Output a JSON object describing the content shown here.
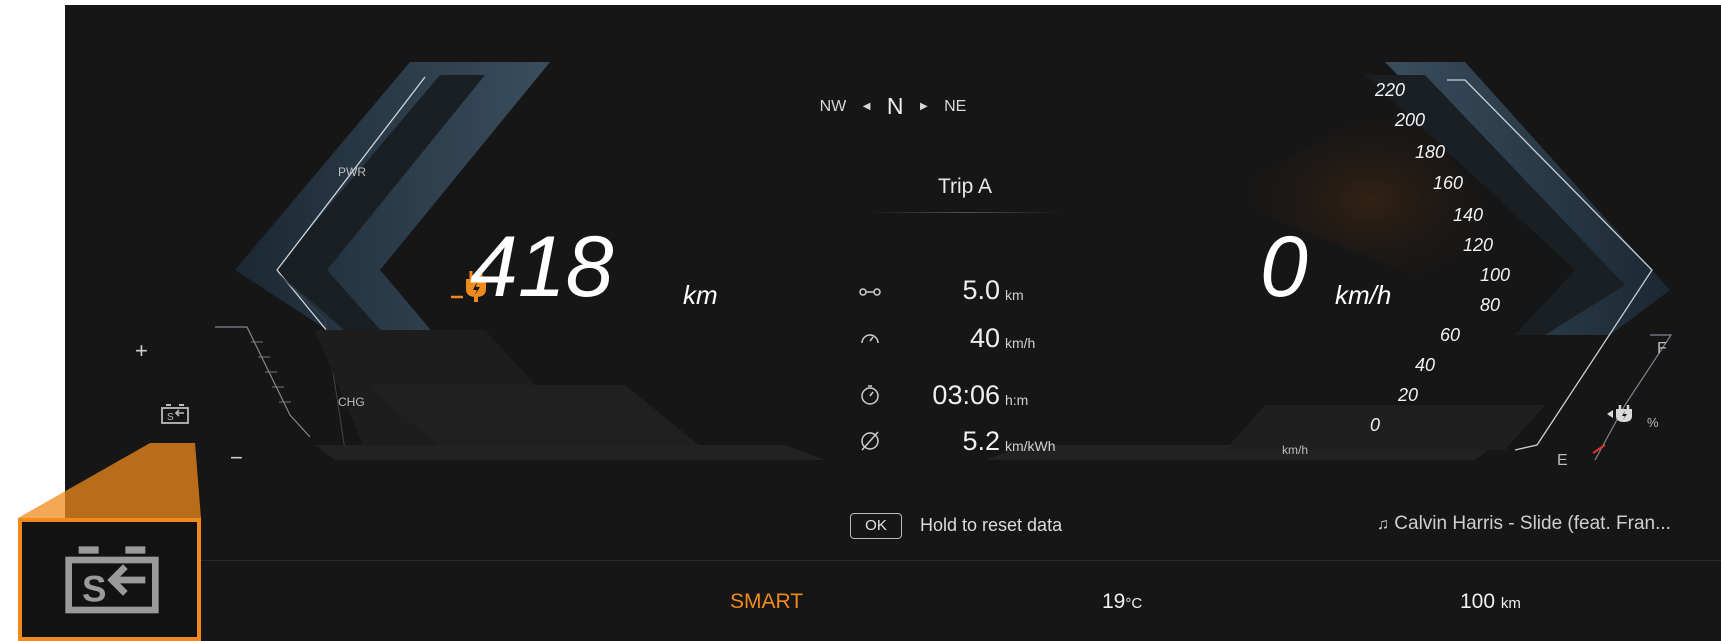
{
  "compass": {
    "left": "NW",
    "heading": "N",
    "right": "NE"
  },
  "trip": {
    "title": "Trip A",
    "rows": [
      {
        "icon": "distance-icon",
        "value": "5.0",
        "unit": "km"
      },
      {
        "icon": "speedometer-icon",
        "value": "40",
        "unit": "km/h"
      },
      {
        "icon": "stopwatch-icon",
        "value": "03:06",
        "unit": "h:m"
      },
      {
        "icon": "average-icon",
        "value": "5.2",
        "unit": "km/kWh"
      }
    ],
    "reset_key": "OK",
    "reset_hint": "Hold to reset data"
  },
  "range": {
    "value": "418",
    "unit": "km",
    "icon": "charging-plug-icon",
    "color": "#f08a1c"
  },
  "power_gauge": {
    "top_label": "PWR",
    "bottom_label": "CHG",
    "plus": "+",
    "minus": "−",
    "battery_icon": "battery-icon"
  },
  "speed": {
    "value": "0",
    "unit": "km/h",
    "scale_unit": "km/h",
    "scale": [
      "220",
      "200",
      "180",
      "160",
      "140",
      "120",
      "100",
      "80",
      "60",
      "40",
      "20",
      "0"
    ]
  },
  "charge_gauge": {
    "full": "F",
    "empty": "E",
    "percent": "%",
    "icon": "battery-charge-icon"
  },
  "media": {
    "icon": "music-note-icon",
    "now_playing": "Calvin Harris - Slide (feat. Fran..."
  },
  "footer": {
    "mode": "SMART",
    "mode_color": "#f08a1c",
    "temp_value": "19",
    "temp_unit": "°C",
    "range_value": "100",
    "range_unit": "km"
  },
  "inset": {
    "icon": "battery-icon",
    "accent": "#f08a1c"
  }
}
